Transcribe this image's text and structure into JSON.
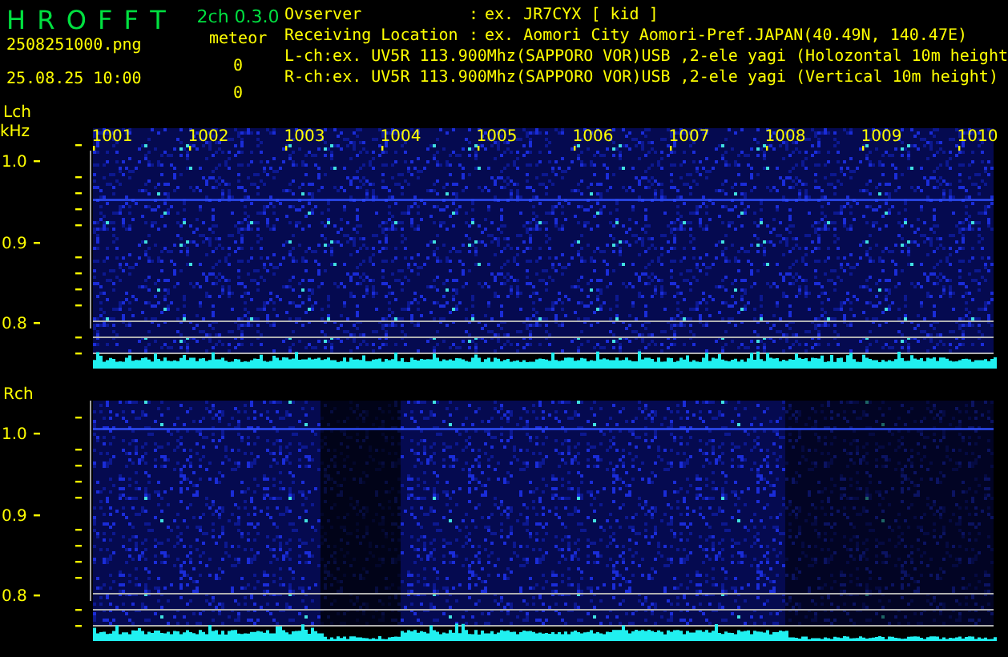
{
  "header": {
    "app_title": "H R O F F T",
    "version": "2ch 0.3.0",
    "file_name": "2508251000.png",
    "date_time": "25.08.25 10:00",
    "meteor_label": "meteor",
    "counts": [
      "0",
      "0"
    ],
    "info": [
      {
        "label": "Ovserver",
        "separator": ":",
        "value": "ex. JR7CYX [ kid ]"
      },
      {
        "label": "Receiving Location",
        "separator": ":",
        "value": "ex. Aomori City Aomori-Pref.JAPAN(40.49N, 140.47E)"
      },
      {
        "label": "L-ch:ex. UV5R 113.900Mhz(SAPPORO VOR)USB ,2-ele yagi (Holozontal 10m height"
      },
      {
        "label": "R-ch:ex. UV5R 113.900Mhz(SAPPORO VOR)USB ,2-ele yagi (Vertical 10m height)"
      }
    ]
  },
  "panels": [
    {
      "channel": "Lch",
      "unit": "kHz",
      "time_ticks": [
        "1001",
        "1002",
        "1003",
        "1004",
        "1005",
        "1006",
        "1007",
        "1008",
        "1009",
        "1010"
      ],
      "freq_ticks": [
        "1.0",
        "0.9",
        "0.8"
      ]
    },
    {
      "channel": "Rch",
      "freq_ticks": [
        "1.0",
        "0.9",
        "0.8"
      ]
    }
  ]
}
